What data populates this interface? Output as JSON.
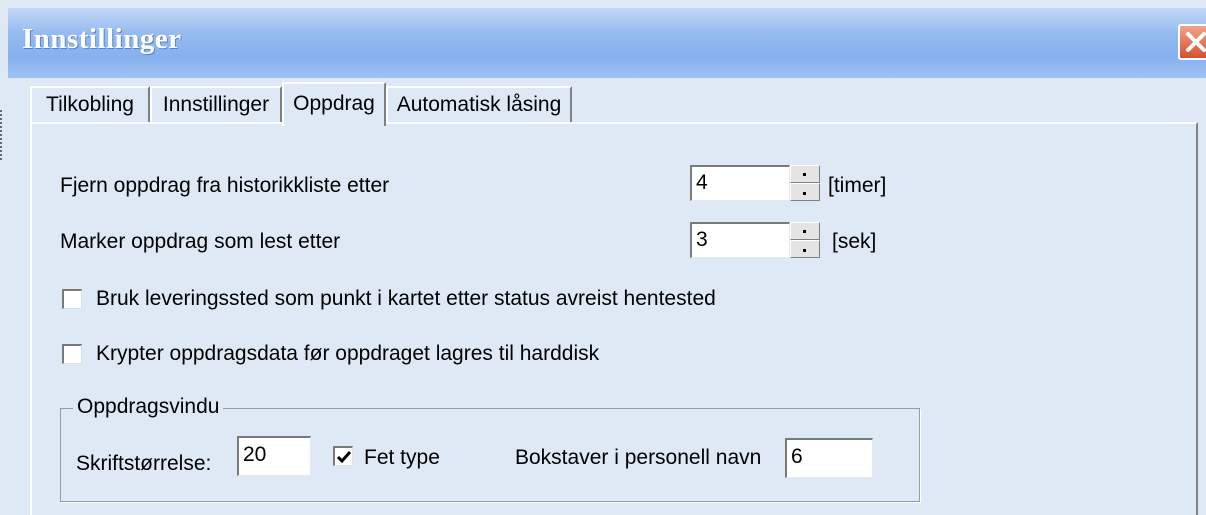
{
  "window": {
    "title": "Innstillinger",
    "close_icon": "close-icon"
  },
  "tabs": [
    {
      "label": "Tilkobling",
      "active": false
    },
    {
      "label": "Innstillinger",
      "active": false
    },
    {
      "label": "Oppdrag",
      "active": true
    },
    {
      "label": "Automatisk låsing",
      "active": false
    }
  ],
  "oppdrag": {
    "remove_history": {
      "label": "Fjern oppdrag fra historikkliste etter",
      "value": "4",
      "unit": "[timer]"
    },
    "mark_read": {
      "label": "Marker oppdrag som lest etter",
      "value": "3",
      "unit": "[sek]"
    },
    "use_delivery_point": {
      "label": "Bruk leveringssted som punkt i kartet etter status avreist hentested",
      "checked": false
    },
    "encrypt_data": {
      "label": "Krypter oppdragsdata før oppdraget lagres til harddisk",
      "checked": false
    },
    "window_group": {
      "legend": "Oppdragsvindu",
      "font_size_label": "Skriftstørrelse:",
      "font_size_value": "20",
      "bold_label": "Fet type",
      "bold_checked": true,
      "letters_label": "Bokstaver i personell navn",
      "letters_value": "6"
    }
  },
  "colors": {
    "titlebar": "#97bbf0",
    "background": "#dfe8f5",
    "close": "#d6512d"
  }
}
